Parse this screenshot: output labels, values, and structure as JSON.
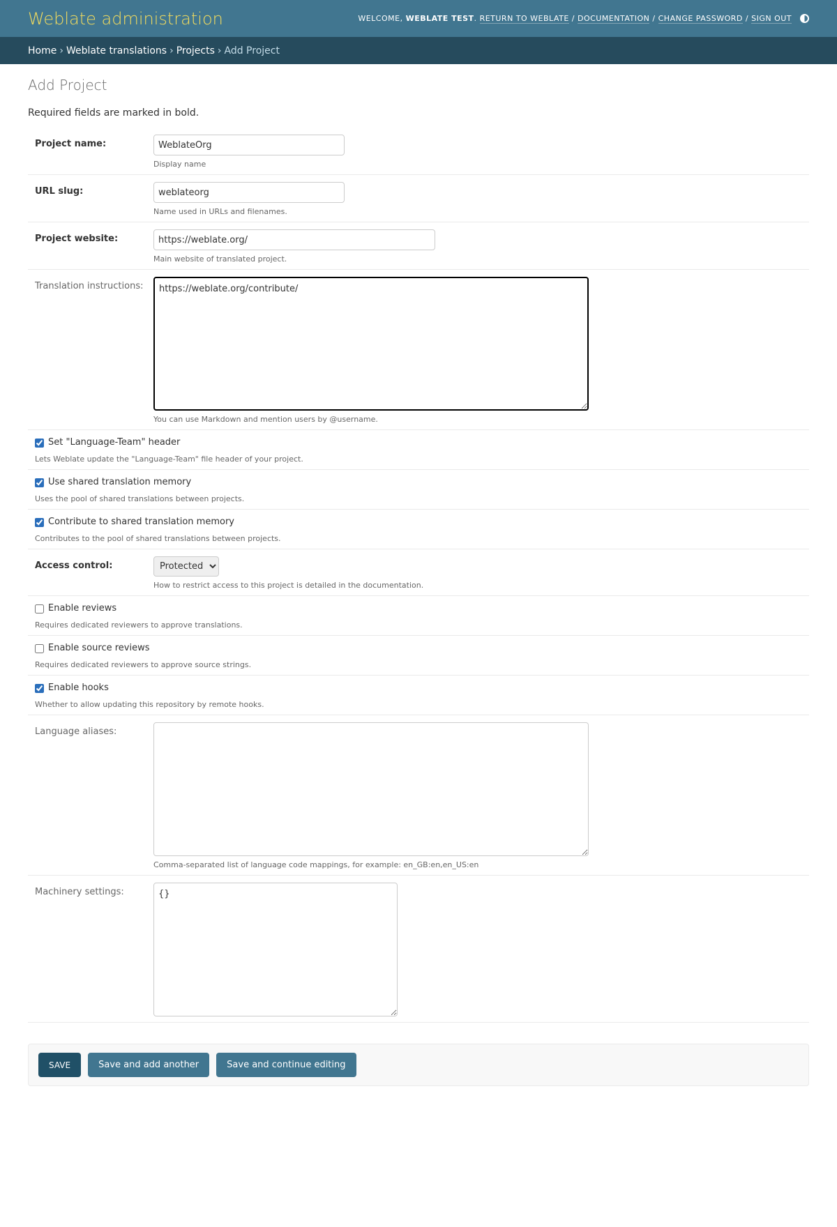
{
  "header": {
    "branding": "Weblate administration",
    "welcome": "WELCOME,",
    "username": "WEBLATE TEST",
    "links": [
      "RETURN TO WEBLATE",
      "DOCUMENTATION",
      "CHANGE PASSWORD",
      "SIGN OUT"
    ],
    "separator": "/",
    "theme_icon": "contrast-icon"
  },
  "breadcrumbs": [
    "Home",
    "Weblate translations",
    "Projects",
    "Add Project"
  ],
  "breadcrumb_arrow": "›",
  "page": {
    "title": "Add Project",
    "required_note": "Required fields are marked in bold."
  },
  "fields": {
    "project_name": {
      "label": "Project name:",
      "value": "WeblateOrg",
      "help": "Display name"
    },
    "url_slug": {
      "label": "URL slug:",
      "value": "weblateorg",
      "help": "Name used in URLs and filenames."
    },
    "project_website": {
      "label": "Project website:",
      "value": "https://weblate.org/",
      "help": "Main website of translated project."
    },
    "translation_instructions": {
      "label": "Translation instructions:",
      "value": "https://weblate.org/contribute/",
      "help": "You can use Markdown and mention users by @username."
    },
    "language_team": {
      "label": "Set \"Language-Team\" header",
      "checked": true,
      "help": "Lets Weblate update the \"Language-Team\" file header of your project."
    },
    "use_shared_tm": {
      "label": "Use shared translation memory",
      "checked": true,
      "help": "Uses the pool of shared translations between projects."
    },
    "contribute_shared_tm": {
      "label": "Contribute to shared translation memory",
      "checked": true,
      "help": "Contributes to the pool of shared translations between projects."
    },
    "access_control": {
      "label": "Access control:",
      "value": "Protected",
      "help": "How to restrict access to this project is detailed in the documentation."
    },
    "enable_reviews": {
      "label": "Enable reviews",
      "checked": false,
      "help": "Requires dedicated reviewers to approve translations."
    },
    "enable_source_reviews": {
      "label": "Enable source reviews",
      "checked": false,
      "help": "Requires dedicated reviewers to approve source strings."
    },
    "enable_hooks": {
      "label": "Enable hooks",
      "checked": true,
      "help": "Whether to allow updating this repository by remote hooks."
    },
    "language_aliases": {
      "label": "Language aliases:",
      "value": "",
      "help": "Comma-separated list of language code mappings, for example: en_GB:en,en_US:en"
    },
    "machinery_settings": {
      "label": "Machinery settings:",
      "value": "{}"
    }
  },
  "buttons": {
    "save": "SAVE",
    "save_add_another": "Save and add another",
    "save_continue": "Save and continue editing"
  }
}
